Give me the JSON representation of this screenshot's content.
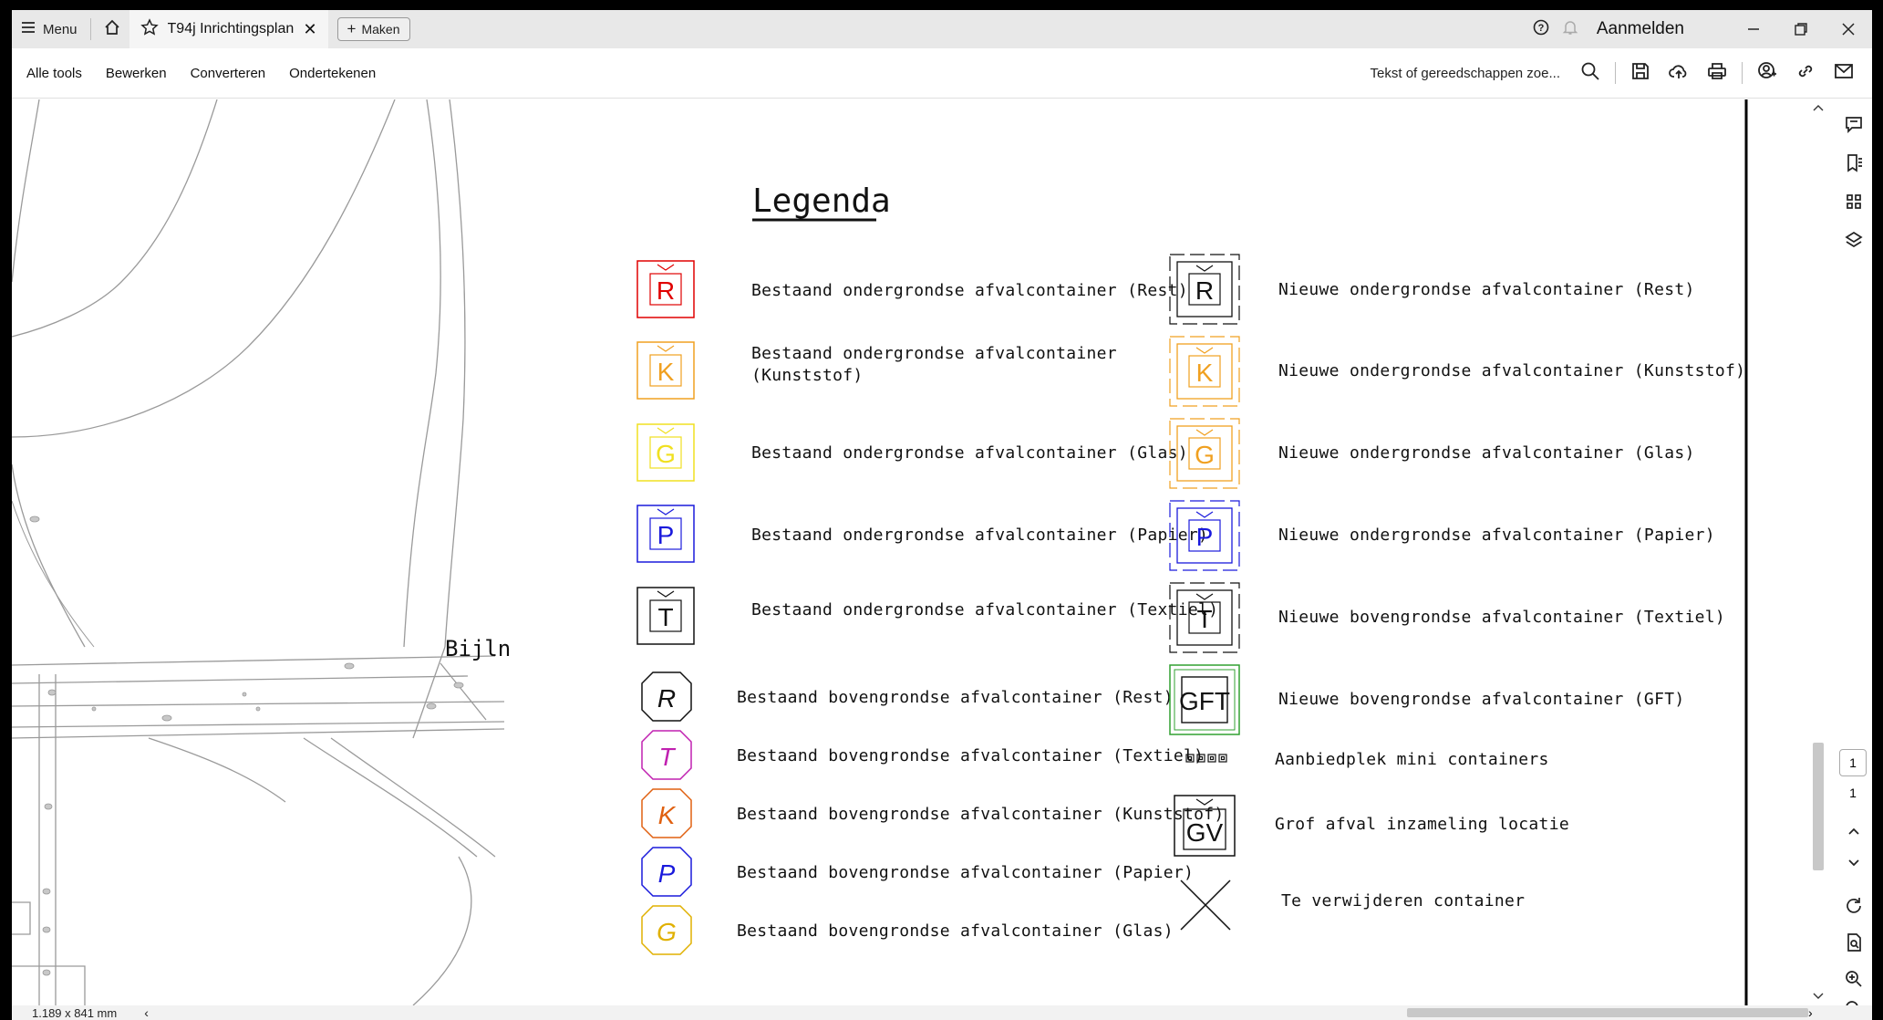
{
  "titlebar": {
    "menu_label": "Menu",
    "tab_title": "T94j Inrichtingsplan ...",
    "new_label": "Maken",
    "login_label": "Aanmelden"
  },
  "toolbar": {
    "menu_items": [
      "Alle tools",
      "Bewerken",
      "Converteren",
      "Ondertekenen"
    ],
    "search_placeholder": "Tekst of gereedschappen zoe..."
  },
  "drawing": {
    "street_label": "Bijln",
    "legend_title": "Legenda",
    "existing_underground": [
      {
        "letter": "R",
        "color": "#e00000",
        "label": "Bestaand ondergrondse afvalcontainer (Rest)"
      },
      {
        "letter": "K",
        "color": "#f0a020",
        "label": "Bestaand ondergrondse afvalcontainer",
        "label2": "(Kunststof)"
      },
      {
        "letter": "G",
        "color": "#f0e020",
        "label": "Bestaand ondergrondse afvalcontainer (Glas)"
      },
      {
        "letter": "P",
        "color": "#1a1adc",
        "label": "Bestaand ondergrondse afvalcontainer (Papier)"
      },
      {
        "letter": "T",
        "color": "#111111",
        "label": "Bestaand ondergrondse afvalcontainer (Textiel)"
      }
    ],
    "existing_aboveground": [
      {
        "letter": "R",
        "color": "#111111",
        "label": "Bestaand bovengrondse afvalcontainer (Rest)"
      },
      {
        "letter": "T",
        "color": "#c020b0",
        "label": "Bestaand bovengrondse afvalcontainer (Textiel)"
      },
      {
        "letter": "K",
        "color": "#e06010",
        "label": "Bestaand bovengrondse afvalcontainer (Kunststof)"
      },
      {
        "letter": "P",
        "color": "#1a1adc",
        "label": "Bestaand bovengrondse afvalcontainer (Papier)"
      },
      {
        "letter": "G",
        "color": "#e0b000",
        "label": "Bestaand bovengrondse afvalcontainer (Glas)"
      }
    ],
    "new_containers": [
      {
        "letter": "R",
        "color": "#111111",
        "label": "Nieuwe ondergrondse afvalcontainer (Rest)"
      },
      {
        "letter": "K",
        "color": "#f0a020",
        "label": "Nieuwe ondergrondse afvalcontainer (Kunststof)"
      },
      {
        "letter": "G",
        "color": "#f0a020",
        "label": "Nieuwe ondergrondse afvalcontainer (Glas)"
      },
      {
        "letter": "P",
        "color": "#1a1adc",
        "label": "Nieuwe ondergrondse afvalcontainer (Papier)"
      },
      {
        "letter": "T",
        "color": "#111111",
        "label": "Nieuwe bovengrondse afvalcontainer (Textiel)"
      },
      {
        "letter": "GFT",
        "color": "#30a030",
        "label": "Nieuwe bovengrondse afvalcontainer (GFT)"
      }
    ],
    "other": [
      {
        "label": "Aanbiedplek mini containers"
      },
      {
        "letter": "GV",
        "label": "Grof afval inzameling locatie"
      },
      {
        "label": "Te verwijderen container"
      }
    ]
  },
  "rail": {
    "current_page": "1",
    "total_pages": "1"
  },
  "status": {
    "page_size": "1.189 x 841 mm"
  }
}
